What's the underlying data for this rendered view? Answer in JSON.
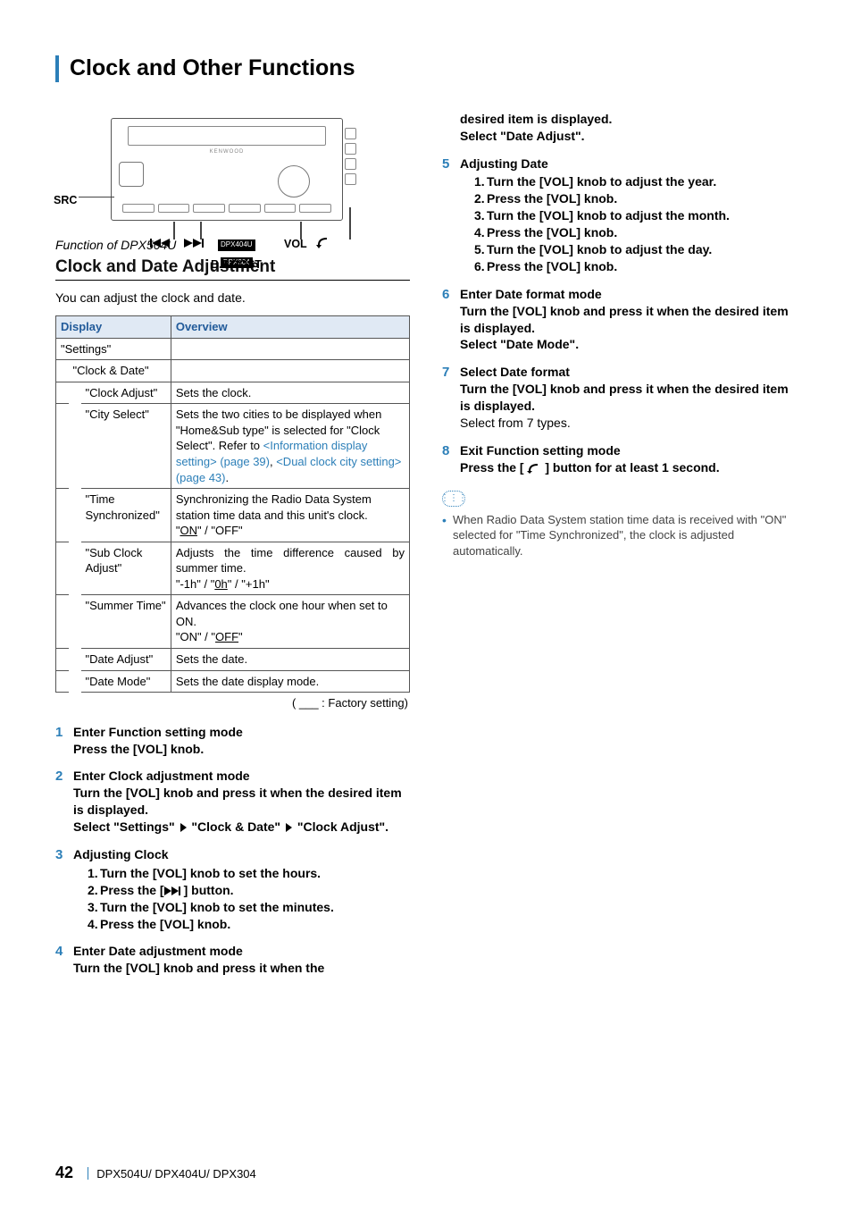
{
  "page_title": "Clock and Other Functions",
  "device": {
    "src_label": "SRC",
    "vol_label": "VOL",
    "bboost_label": "B.BOOST",
    "tag1": "DPX404U",
    "tag2": "DPX304",
    "brand": "KENWOOD"
  },
  "section": {
    "func_of": "Function of DPX504U",
    "heading": "Clock and Date Adjustment",
    "lead": "You can adjust the clock and date."
  },
  "table": {
    "h_display": "Display",
    "h_overview": "Overview",
    "r_settings": "\"Settings\"",
    "r_clockdate": "\"Clock & Date\"",
    "rows": [
      {
        "d": "\"Clock Adjust\"",
        "o": "Sets the clock."
      },
      {
        "d": "\"City Select\"",
        "o_a": "Sets the two cities to be displayed when \"Home&Sub type\" is selected for \"Clock Select\". Refer to ",
        "o_l1": "<Information display setting> (page 39)",
        "o_m": ", ",
        "o_l2": "<Dual clock city setting> (page 43)",
        "o_z": "."
      },
      {
        "d": "\"Time Synchronized\"",
        "o": "Synchronizing the Radio Data System station time data and this unit's clock.",
        "opt_a": "ON",
        "opt_sep1": "\" / \"",
        "opt_b": "OFF"
      },
      {
        "d": "\"Sub Clock Adjust\"",
        "o": "Adjusts the time difference caused by summer time.",
        "opt_a": "-1h",
        "opt_sep1": "\" / \"",
        "opt_b": "0h",
        "opt_sep2": "\" / \"",
        "opt_c": "+1h"
      },
      {
        "d": "\"Summer Time\"",
        "o": "Advances the clock one hour when set to ON.",
        "opt_a": "ON",
        "opt_sep1": "\" / \"",
        "opt_b": "OFF"
      },
      {
        "d": "\"Date Adjust\"",
        "o": "Sets the date."
      },
      {
        "d": "\"Date Mode\"",
        "o": "Sets the date display mode."
      }
    ],
    "factory_note": "( ___ : Factory setting)"
  },
  "steps_left": {
    "s1_t": "Enter Function setting mode",
    "s1_b": "Press the [VOL] knob.",
    "s2_t": "Enter Clock adjustment mode",
    "s2_b1": "Turn the [VOL] knob and press it when the desired item is displayed.",
    "s2_b2a": "Select \"Settings\" ",
    "s2_b2b": " \"Clock & Date\" ",
    "s2_b2c": " \"Clock Adjust\".",
    "s3_t": "Adjusting Clock",
    "s3_1": "Turn the [VOL] knob to set the hours.",
    "s3_2a": "Press the [",
    "s3_2b": "] button.",
    "s3_3": "Turn the [VOL] knob to set the minutes.",
    "s3_4": "Press the [VOL] knob.",
    "s4_t": "Enter Date adjustment mode",
    "s4_b": "Turn the [VOL] knob and press it when the"
  },
  "steps_right": {
    "cont1": "desired item is displayed.",
    "cont2": "Select \"Date Adjust\".",
    "s5_t": "Adjusting Date",
    "s5_1": "Turn the [VOL] knob to adjust the year.",
    "s5_2": "Press the [VOL] knob.",
    "s5_3": "Turn the [VOL] knob to adjust the month.",
    "s5_4": "Press the [VOL] knob.",
    "s5_5": "Turn the [VOL] knob to adjust the day.",
    "s5_6": "Press the [VOL] knob.",
    "s6_t": "Enter Date format mode",
    "s6_b1": "Turn the [VOL] knob and press it when the desired item is displayed.",
    "s6_b2": "Select \"Date Mode\".",
    "s7_t": "Select Date format",
    "s7_b": "Turn the [VOL] knob and press it when the desired item is displayed.",
    "s7_n": "Select from 7 types.",
    "s8_t": "Exit Function setting mode",
    "s8_b1": "Press the [ ",
    "s8_b2": " ] button for at least 1 second."
  },
  "note": "When Radio Data System station time data is received with \"ON\" selected for \"Time Synchronized\", the clock is adjusted automatically.",
  "footer": {
    "page": "42",
    "models": "DPX504U/ DPX404U/ DPX304"
  }
}
